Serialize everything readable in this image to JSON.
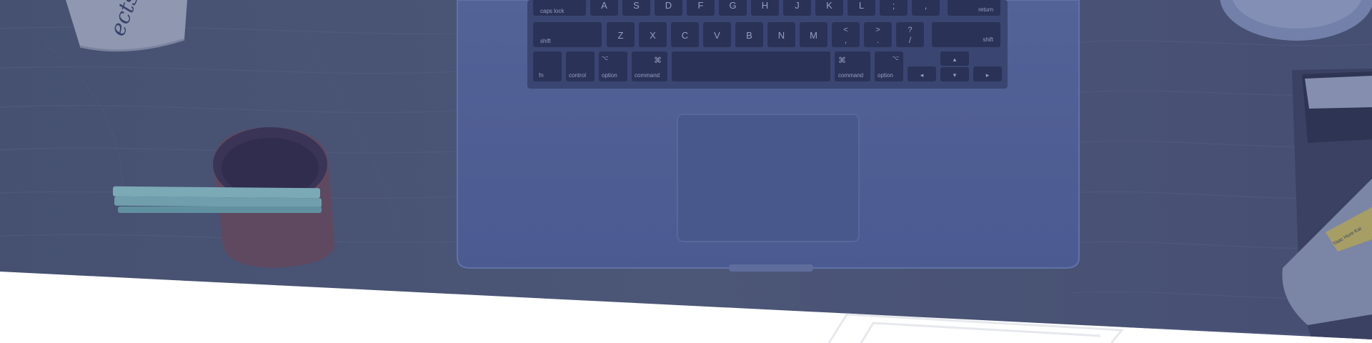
{
  "scene": {
    "description_free": true,
    "colors": {
      "overlay_navy": "#3a4878",
      "desk_wood": "#4d5570",
      "desk_grain": "#5c6482",
      "laptop_body": "#56669a",
      "laptop_edge": "#6b7bb0",
      "keyboard_well": "#3c4772",
      "key": "#2a3154",
      "trackpad": "#4c5b8e",
      "cup_wall": "#a6acbf",
      "pencil_cup": "#6a4a5a",
      "pencils": "#8fc7c9",
      "book_cover": "#8f98b4",
      "book_label": "#c8b85f",
      "white_band": "#ffffff",
      "outline_gray": "#e4e6ec"
    },
    "icons": {
      "command_icon": "⌘",
      "option_icon": "⌥",
      "arrow_left": "◂",
      "arrow_right": "▸",
      "arrow_up": "▴",
      "arrow_down": "▾"
    }
  },
  "cup": {
    "text": "ects"
  },
  "book": {
    "label_text": "Yaac Hure Kai"
  },
  "keyboard": {
    "row1": {
      "left_label": "caps lock",
      "keys": [
        "A",
        "S",
        "D",
        "F",
        "G",
        "H",
        "J",
        "K",
        "L",
        ";",
        ","
      ],
      "right_label": "return"
    },
    "row2": {
      "left_label": "shift",
      "keys": [
        "Z",
        "X",
        "C",
        "V",
        "B",
        "N",
        "M"
      ],
      "punct": [
        [
          "<",
          ","
        ],
        [
          ">",
          "."
        ],
        [
          "?",
          "/"
        ]
      ],
      "right_label": "shift"
    },
    "row3": {
      "fn": "fn",
      "control": "control",
      "option_left": "option",
      "command_left": "command",
      "command_right": "command",
      "option_right": "option"
    }
  }
}
